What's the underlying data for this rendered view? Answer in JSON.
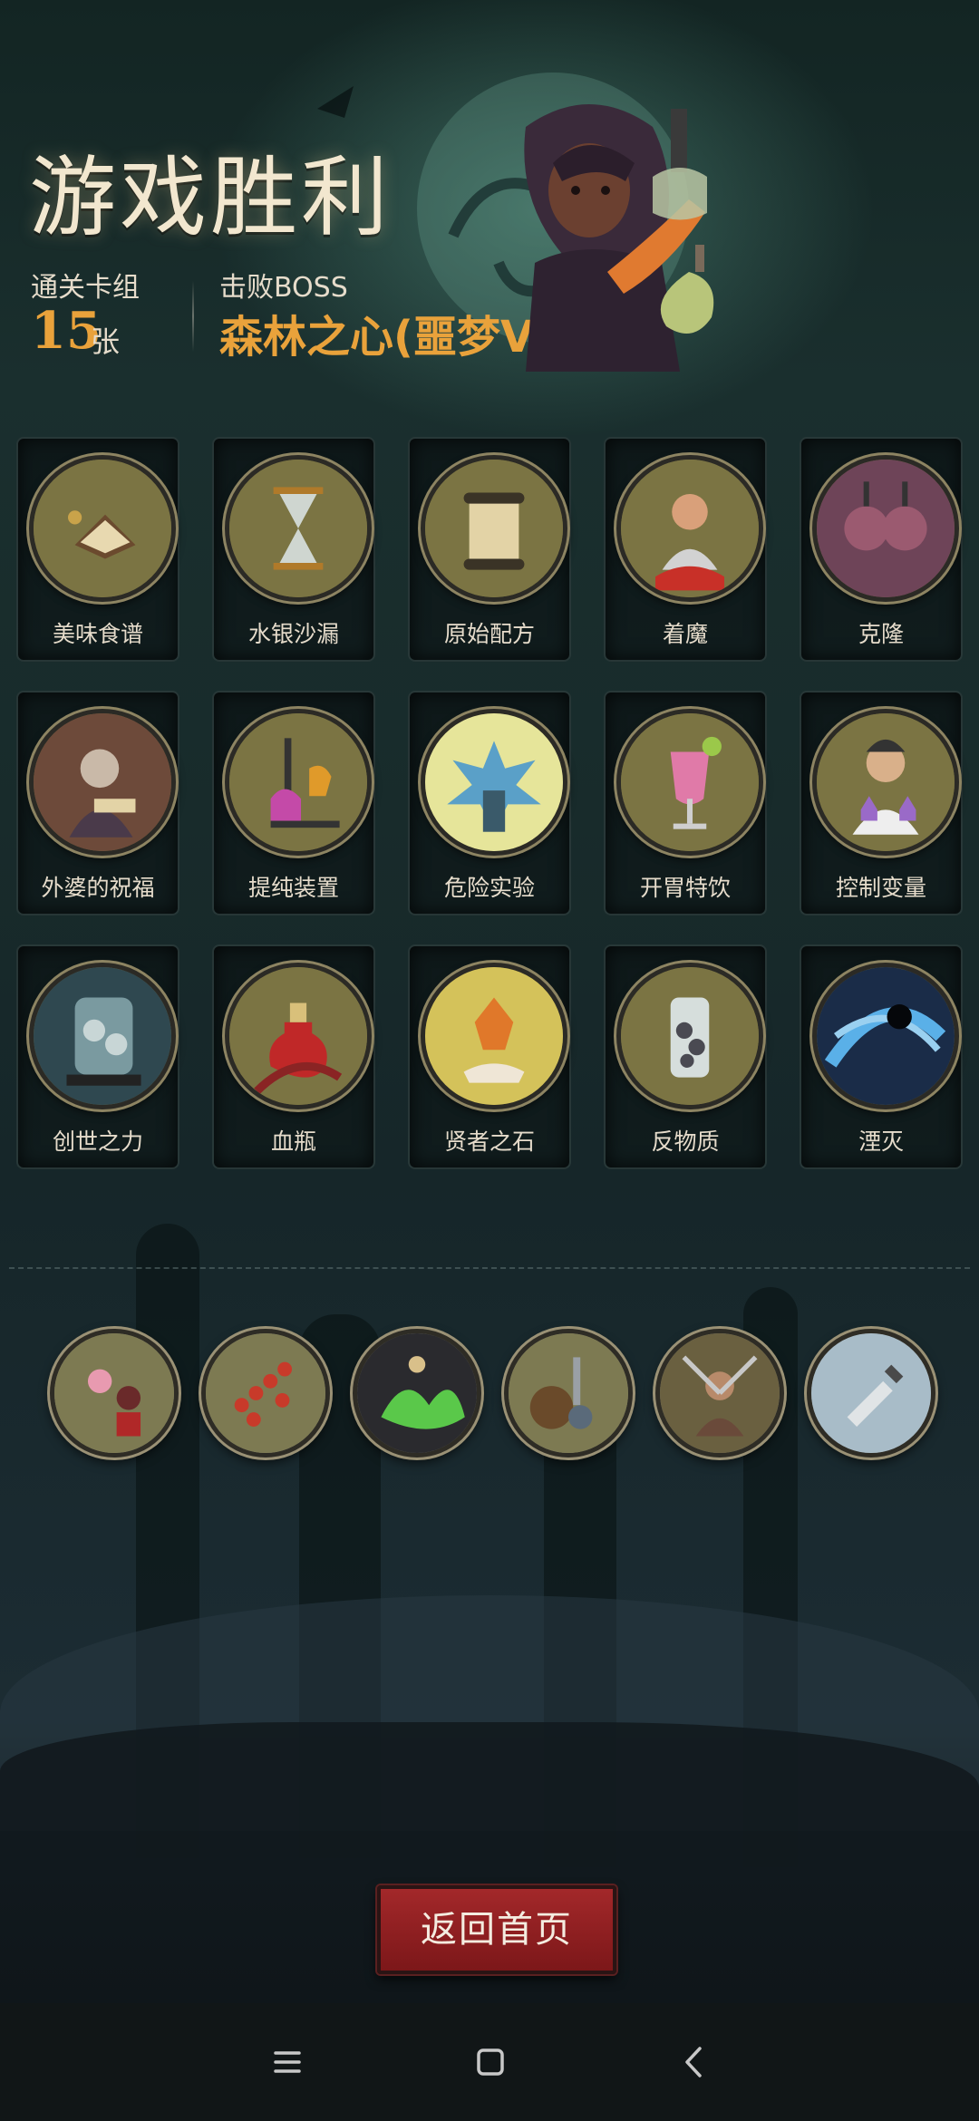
{
  "header": {
    "title": "游戏胜利",
    "deck_label": "通关卡组",
    "deck_count": "15",
    "deck_unit": "张",
    "boss_label": "击败BOSS",
    "boss_name": "森林之心(噩梦VII)"
  },
  "cards": [
    {
      "label": "美味食谱",
      "icon": "recipe-book-icon"
    },
    {
      "label": "水银沙漏",
      "icon": "hourglass-icon"
    },
    {
      "label": "原始配方",
      "icon": "scroll-icon"
    },
    {
      "label": "着魔",
      "icon": "possessed-man-icon"
    },
    {
      "label": "克隆",
      "icon": "clone-pods-icon"
    },
    {
      "label": "外婆的祝福",
      "icon": "grandma-reading-icon"
    },
    {
      "label": "提纯装置",
      "icon": "distillation-apparatus-icon"
    },
    {
      "label": "危险实验",
      "icon": "explosion-beaker-icon"
    },
    {
      "label": "开胃特饮",
      "icon": "cocktail-icon"
    },
    {
      "label": "控制变量",
      "icon": "scientist-icon"
    },
    {
      "label": "创世之力",
      "icon": "genesis-tank-icon"
    },
    {
      "label": "血瓶",
      "icon": "blood-potion-icon"
    },
    {
      "label": "贤者之石",
      "icon": "philosopher-stone-icon"
    },
    {
      "label": "反物质",
      "icon": "antimatter-tube-icon"
    },
    {
      "label": "湮灭",
      "icon": "annihilation-vortex-icon"
    }
  ],
  "relics": [
    {
      "icon": "musicians-relic-icon"
    },
    {
      "icon": "dna-strand-relic-icon"
    },
    {
      "icon": "green-flame-relic-icon"
    },
    {
      "icon": "cauldron-relic-icon"
    },
    {
      "icon": "warrior-relic-icon"
    },
    {
      "icon": "dagger-relic-icon"
    }
  ],
  "footer": {
    "return_label": "返回首页"
  },
  "navbar": {
    "menu_icon": "menu-icon",
    "home_icon": "home-square-icon",
    "back_icon": "back-chevron-icon"
  },
  "colors": {
    "accent_gold": "#e9a23b",
    "title_cream": "#f2e7cf",
    "button_red": "#a3282a",
    "disc_olive": "#7b7443"
  }
}
